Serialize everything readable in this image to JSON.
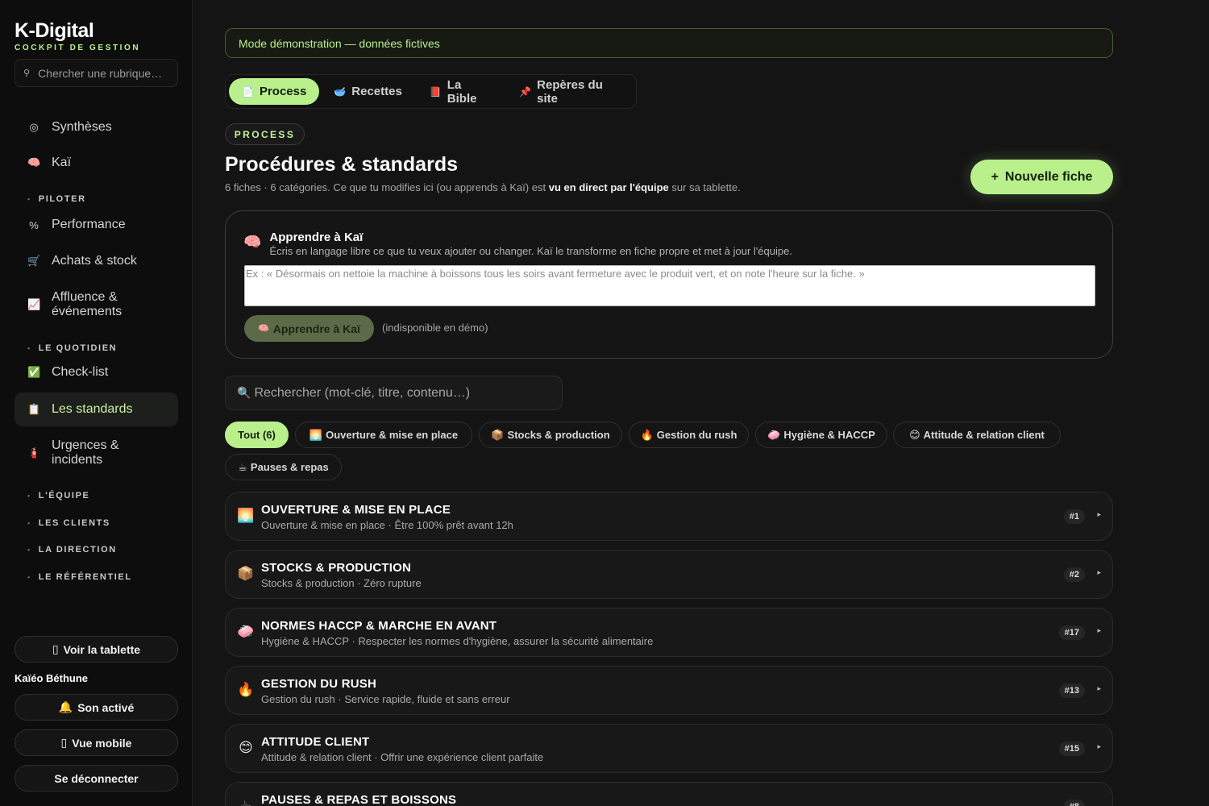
{
  "brand": {
    "name": "K-Digital",
    "subtitle": "COCKPIT DE GESTION"
  },
  "sidebar": {
    "search_placeholder": "Chercher une rubrique…",
    "items": [
      {
        "label": "Synthèses",
        "icon": "target-icon",
        "glyph": "◎"
      },
      {
        "label": "Kaï",
        "icon": "brain-icon",
        "glyph": "🧠"
      },
      {
        "label": "Performance",
        "icon": "percent-icon",
        "glyph": "%"
      },
      {
        "label": "Achats & stock",
        "icon": "cart-icon",
        "glyph": "🛒"
      },
      {
        "label": "Affluence & événements",
        "icon": "chart-icon",
        "glyph": "📈"
      },
      {
        "label": "Check-list",
        "icon": "checkbox-icon",
        "glyph": "✅"
      },
      {
        "label": "Les standards",
        "icon": "clipboard-icon",
        "glyph": "📋"
      },
      {
        "label": "Urgences & incidents",
        "icon": "extinguisher-icon",
        "glyph": "🧯"
      }
    ],
    "sections": [
      "PILOTER",
      "LE QUOTIDIEN",
      "L'ÉQUIPE",
      "LES CLIENTS",
      "LA DIRECTION",
      "LE RÉFÉRENTIEL"
    ],
    "tablet_button": "Voir la tablette",
    "user_name": "Kaïéo Béthune",
    "sound_button": "Son activé",
    "mobile_button": "Vue mobile",
    "logout_button": "Se déconnecter"
  },
  "banner": "Mode démonstration — données fictives",
  "tabs": [
    {
      "label": "Process",
      "glyph": "📄"
    },
    {
      "label": "Recettes",
      "glyph": "🥣"
    },
    {
      "label": "La Bible",
      "glyph": "📕"
    },
    {
      "label": "Repères du site",
      "glyph": "📌"
    }
  ],
  "header": {
    "kicker": "PROCESS",
    "title": "Procédures & standards",
    "subtitle_pre": "6 fiches · 6 catégories. Ce que tu modifies ici (ou apprends à Kaï) est ",
    "subtitle_bold": "vu en direct par l'équipe",
    "subtitle_post": " sur sa tablette.",
    "new_button": "Nouvelle fiche"
  },
  "kai": {
    "title": "Apprendre à Kaï",
    "description": "Écris en langage libre ce que tu veux ajouter ou changer. Kaï le transforme en fiche propre et met à jour l'équipe.",
    "placeholder": "Ex : « Désormais on nettoie la machine à boissons tous les soirs avant fermeture avec le produit vert, et on note l'heure sur la fiche. »",
    "button": "Apprendre à Kaï",
    "note": "(indisponible en démo)"
  },
  "search": {
    "placeholder": "Rechercher (mot-clé, titre, contenu…)"
  },
  "chips": [
    {
      "label": "Tout (6)",
      "glyph": ""
    },
    {
      "label": "Ouverture & mise en place",
      "glyph": "🌅"
    },
    {
      "label": "Stocks & production",
      "glyph": "📦"
    },
    {
      "label": "Gestion du rush",
      "glyph": "🔥"
    },
    {
      "label": "Hygiène & HACCP",
      "glyph": "🧼"
    },
    {
      "label": "Attitude & relation client",
      "glyph": "😊"
    },
    {
      "label": "Pauses & repas",
      "glyph": "☕"
    }
  ],
  "fiches": [
    {
      "title": "OUVERTURE & MISE EN PLACE",
      "subtitle": "Ouverture & mise en place · Être 100% prêt avant 12h",
      "badge": "#1",
      "glyph": "🌅"
    },
    {
      "title": "STOCKS & PRODUCTION",
      "subtitle": "Stocks & production · Zéro rupture",
      "badge": "#2",
      "glyph": "📦"
    },
    {
      "title": "NORMES HACCP & MARCHE EN AVANT",
      "subtitle": "Hygiène & HACCP · Respecter les normes d'hygiène, assurer la sécurité alimentaire",
      "badge": "#17",
      "glyph": "🧼"
    },
    {
      "title": "GESTION DU RUSH",
      "subtitle": "Gestion du rush · Service rapide, fluide et sans erreur",
      "badge": "#13",
      "glyph": "🔥"
    },
    {
      "title": "ATTITUDE CLIENT",
      "subtitle": "Attitude & relation client · Offrir une expérience client parfaite",
      "badge": "#15",
      "glyph": "😊"
    },
    {
      "title": "PAUSES & REPAS ET BOISSONS",
      "subtitle": "",
      "badge": "#8",
      "glyph": "☕"
    }
  ],
  "colors": {
    "accent": "#b9f08c",
    "background": "#141414",
    "sidebar": "#0d0d0d"
  }
}
